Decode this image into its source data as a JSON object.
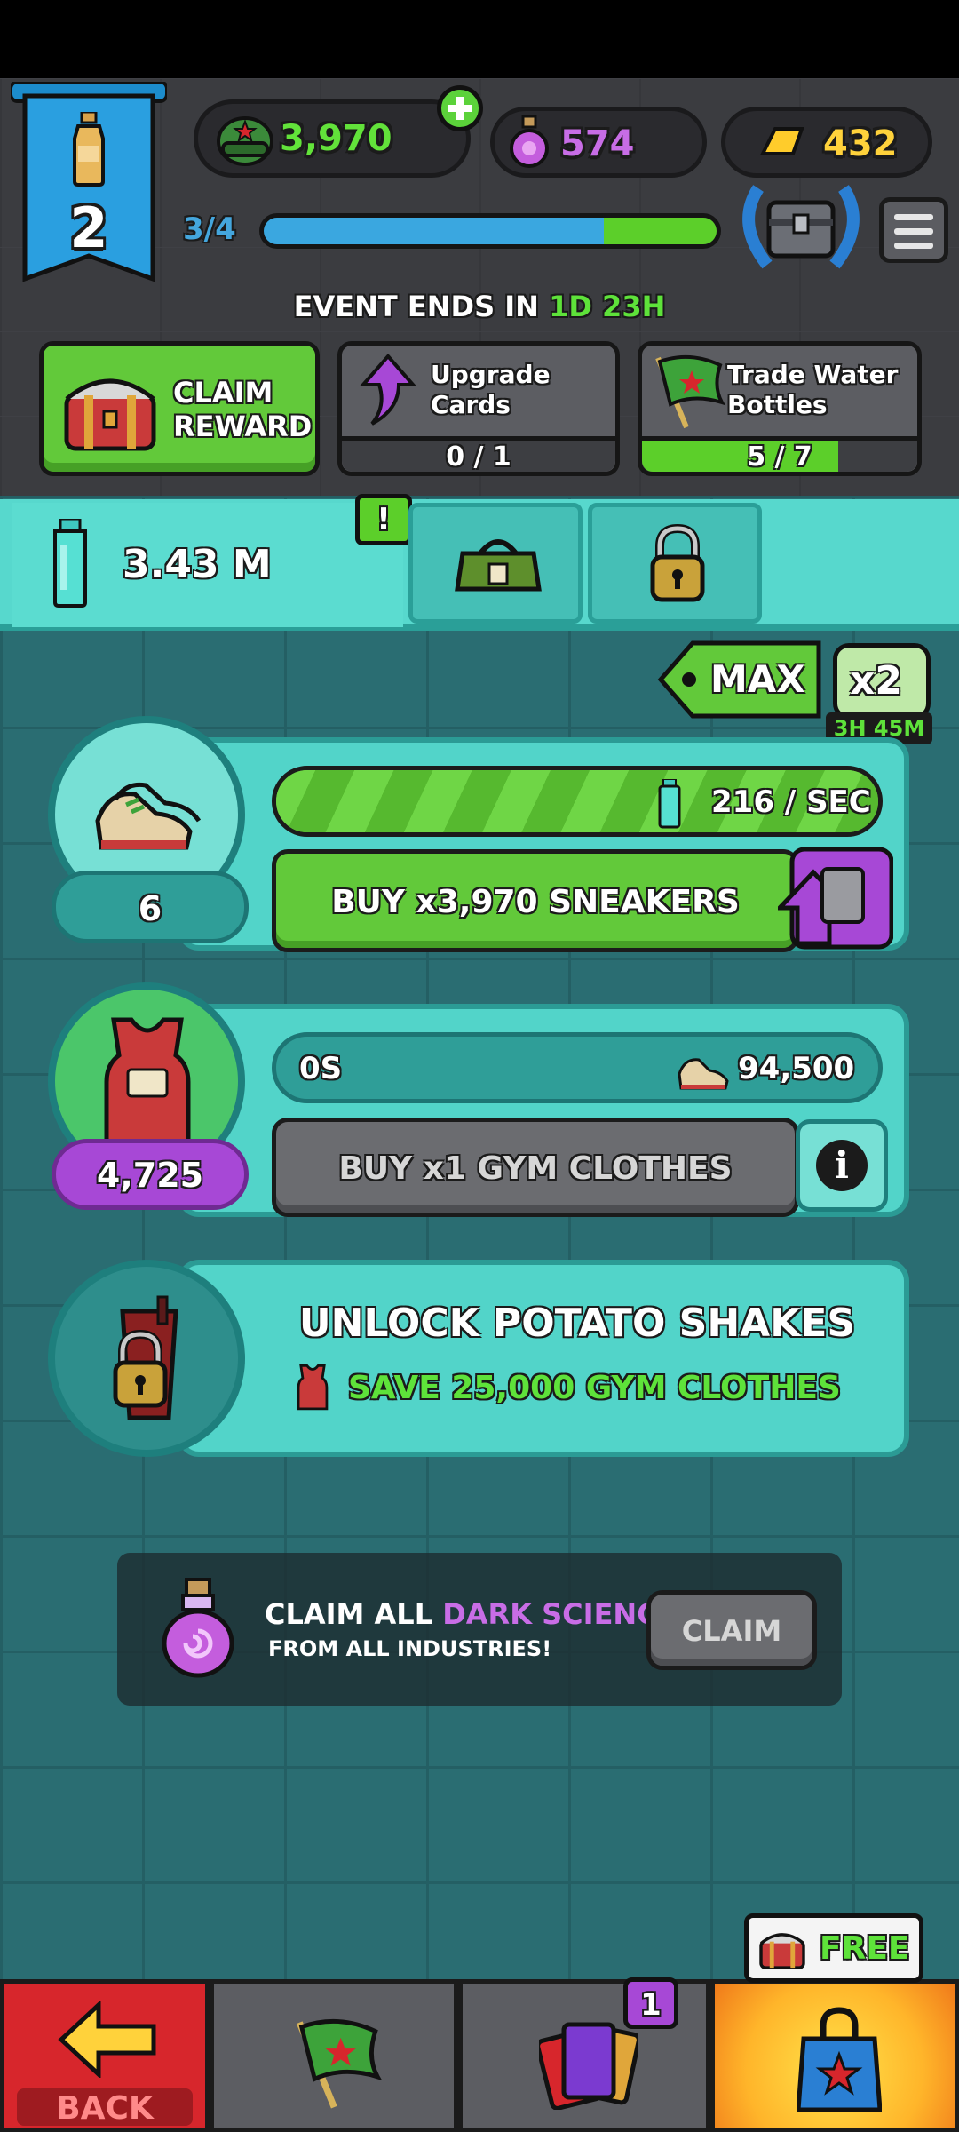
{
  "resources": {
    "helmets": "3,970",
    "dark_science": "574",
    "gold": "432"
  },
  "level": {
    "number": "2",
    "progress_text": "3/4",
    "progress_fraction": 0.75
  },
  "event": {
    "prefix": "EVENT ENDS IN",
    "days": "1D",
    "hours": "23H"
  },
  "tasks": {
    "claim_reward_line1": "CLAIM",
    "claim_reward_line2": "REWARD",
    "upgrade_line1": "Upgrade",
    "upgrade_line2": "Cards",
    "upgrade_progress": "0 / 1",
    "upgrade_fraction": 0.0,
    "trade_line1": "Trade Water",
    "trade_line2": "Bottles",
    "trade_progress": "5 / 7",
    "trade_fraction": 0.714
  },
  "tabs": {
    "bottle_count": "3.43 M",
    "alert_badge": "!"
  },
  "multiplier": {
    "max_label": "MAX",
    "boost_label": "x2",
    "boost_timer": "3H 45M"
  },
  "sneakers": {
    "count": "6",
    "rate": "216 / SEC",
    "buy_label": "BUY x3,970 SNEAKERS"
  },
  "gym_clothes": {
    "count": "4,725",
    "timer": "0S",
    "cost": "94,500",
    "buy_label": "BUY x1 GYM CLOTHES",
    "info": "i"
  },
  "unlock": {
    "title": "UNLOCK POTATO SHAKES",
    "requirement": "SAVE 25,000 GYM CLOTHES"
  },
  "claim_all": {
    "prefix": "CLAIM ALL",
    "highlight": "DARK SCIENCE",
    "line2": "FROM ALL INDUSTRIES!",
    "button": "CLAIM"
  },
  "bottom_nav": {
    "back_label": "BACK",
    "cards_badge": "1",
    "free_label": "FREE"
  },
  "colors": {
    "green": "#62c93a",
    "purple": "#b94bdc",
    "gold": "#ffd23b",
    "teal": "#52d4c9",
    "red": "#d7262c"
  }
}
